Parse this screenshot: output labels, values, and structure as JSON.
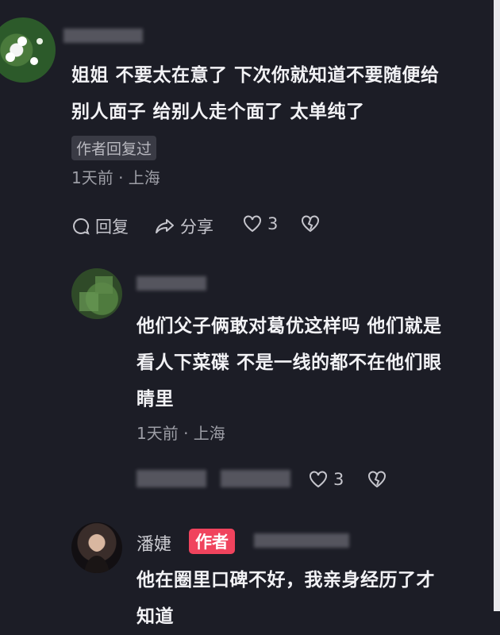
{
  "comments": [
    {
      "text_line1": "姐姐 不要太在意了 下次你就知道不要随便给",
      "text_line2": "别人面子 给别人走个面了 太单纯了",
      "replied_badge": "作者回复过",
      "meta": "1天前 · 上海",
      "reply_label": "回复",
      "share_label": "分享",
      "like_count": "3"
    },
    {
      "name_partial": "...ccs",
      "text_line1": "他们父子俩敢对葛优这样吗 他们就是",
      "text_line2": "看人下菜碟 不是一线的都不在他们眼",
      "text_line3": "睛里",
      "meta": "1天前 · 上海",
      "like_count": "3"
    },
    {
      "name": "潘婕",
      "author_badge": "作者",
      "text_line1": "他在圈里口碑不好，我亲身经历了才",
      "text_line2": "知道"
    }
  ],
  "colors": {
    "background": "#1c1d26",
    "author_badge": "#f0435d",
    "meta_text": "#9d9ea6"
  }
}
